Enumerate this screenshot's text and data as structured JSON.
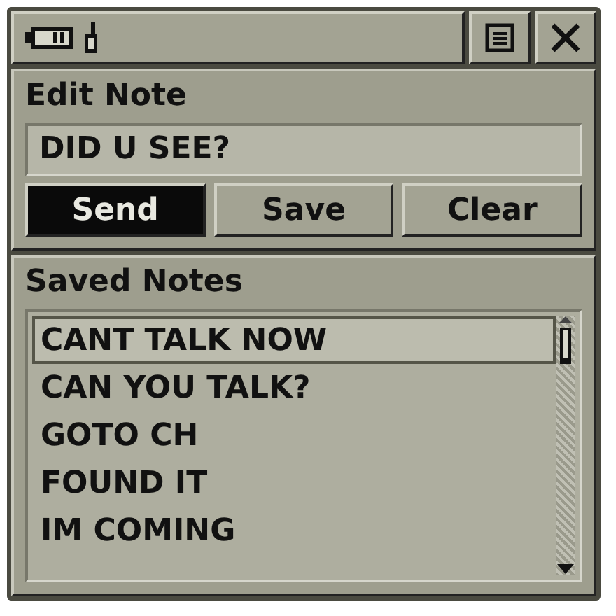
{
  "title_bar": {
    "buttons": [
      {
        "kind": "menu"
      },
      {
        "kind": "close"
      }
    ]
  },
  "edit_note": {
    "heading": "Edit Note",
    "value": "DID U SEE?",
    "buttons": [
      {
        "label": "Send",
        "selected": true
      },
      {
        "label": "Save",
        "selected": false
      },
      {
        "label": "Clear",
        "selected": false
      }
    ]
  },
  "saved_notes": {
    "heading": "Saved Notes",
    "items": [
      {
        "label": "CANT TALK NOW",
        "selected": true
      },
      {
        "label": "CAN YOU TALK?",
        "selected": false
      },
      {
        "label": "GOTO CH",
        "selected": false
      },
      {
        "label": "FOUND IT",
        "selected": false
      },
      {
        "label": "IM COMING",
        "selected": false
      }
    ]
  }
}
